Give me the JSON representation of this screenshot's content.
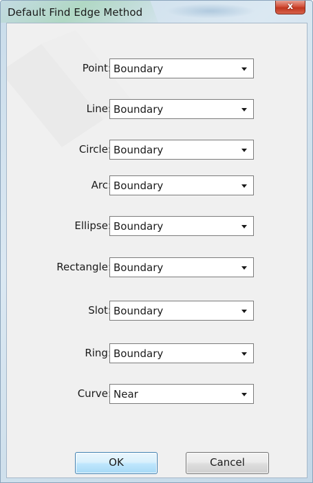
{
  "window": {
    "title": "Default Find Edge Method",
    "close_glyph": "x"
  },
  "fields": [
    {
      "label": "Point:",
      "value": "Boundary"
    },
    {
      "label": "Line:",
      "value": "Boundary"
    },
    {
      "label": "Circle:",
      "value": "Boundary"
    },
    {
      "label": "Arc:",
      "value": "Boundary"
    },
    {
      "label": "Ellipse:",
      "value": "Boundary"
    },
    {
      "label": "Rectangle:",
      "value": "Boundary"
    },
    {
      "label": "Slot:",
      "value": "Boundary"
    },
    {
      "label": "Ring:",
      "value": "Boundary"
    },
    {
      "label": "Curve:",
      "value": "Near"
    }
  ],
  "buttons": {
    "ok_label": "OK",
    "cancel_label": "Cancel"
  },
  "icons": {
    "close": "close-icon",
    "dropdown": "chevron-down-icon"
  },
  "colors": {
    "default_button_border": "#3c7fb1",
    "close_button": "#c0361f",
    "dialog_background": "#f0f0f0"
  }
}
